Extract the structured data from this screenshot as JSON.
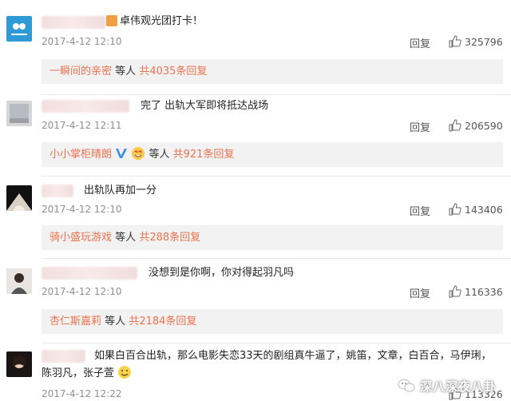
{
  "comments": [
    {
      "text": "卓伟观光团打卡！",
      "time": "2017-4-12 12:10",
      "reply_label": "回复",
      "likes": "325796",
      "sub_user": "一瞬间的亲密",
      "sub_mid": "等人",
      "sub_count": "共4035条回复"
    },
    {
      "text": "完了 出轨大军即将抵达战场",
      "time": "2017-4-12 12:11",
      "reply_label": "回复",
      "likes": "206590",
      "sub_user": "小小掌柜晴朗",
      "sub_mid": "等人",
      "sub_count": "共921条回复"
    },
    {
      "text": "出轨队再加一分",
      "time": "2017-4-12 12:10",
      "reply_label": "回复",
      "likes": "143406",
      "sub_user": "骑小盛玩游戏",
      "sub_mid": "等人",
      "sub_count": "共288条回复"
    },
    {
      "text": "没想到是你啊，你对得起羽凡吗",
      "time": "2017-4-12 12:10",
      "reply_label": "回复",
      "likes": "116336",
      "sub_user": "杏仁斯嘉莉",
      "sub_mid": "等人",
      "sub_count": "共2184条回复"
    },
    {
      "text_line1": "如果白百合出轨，那么电影失恋33天的剧组真牛逼了，姚笛，文章，白百合，马伊琍，",
      "text_line2": "陈羽凡，张子萱",
      "time": "2017-4-12 12:22",
      "likes": "113326"
    }
  ],
  "watermark": "深八深夜八卦",
  "colors": {
    "accent": "#eb7350",
    "meta": "#8f8f8f",
    "sub_bg": "#f2f2f2"
  }
}
